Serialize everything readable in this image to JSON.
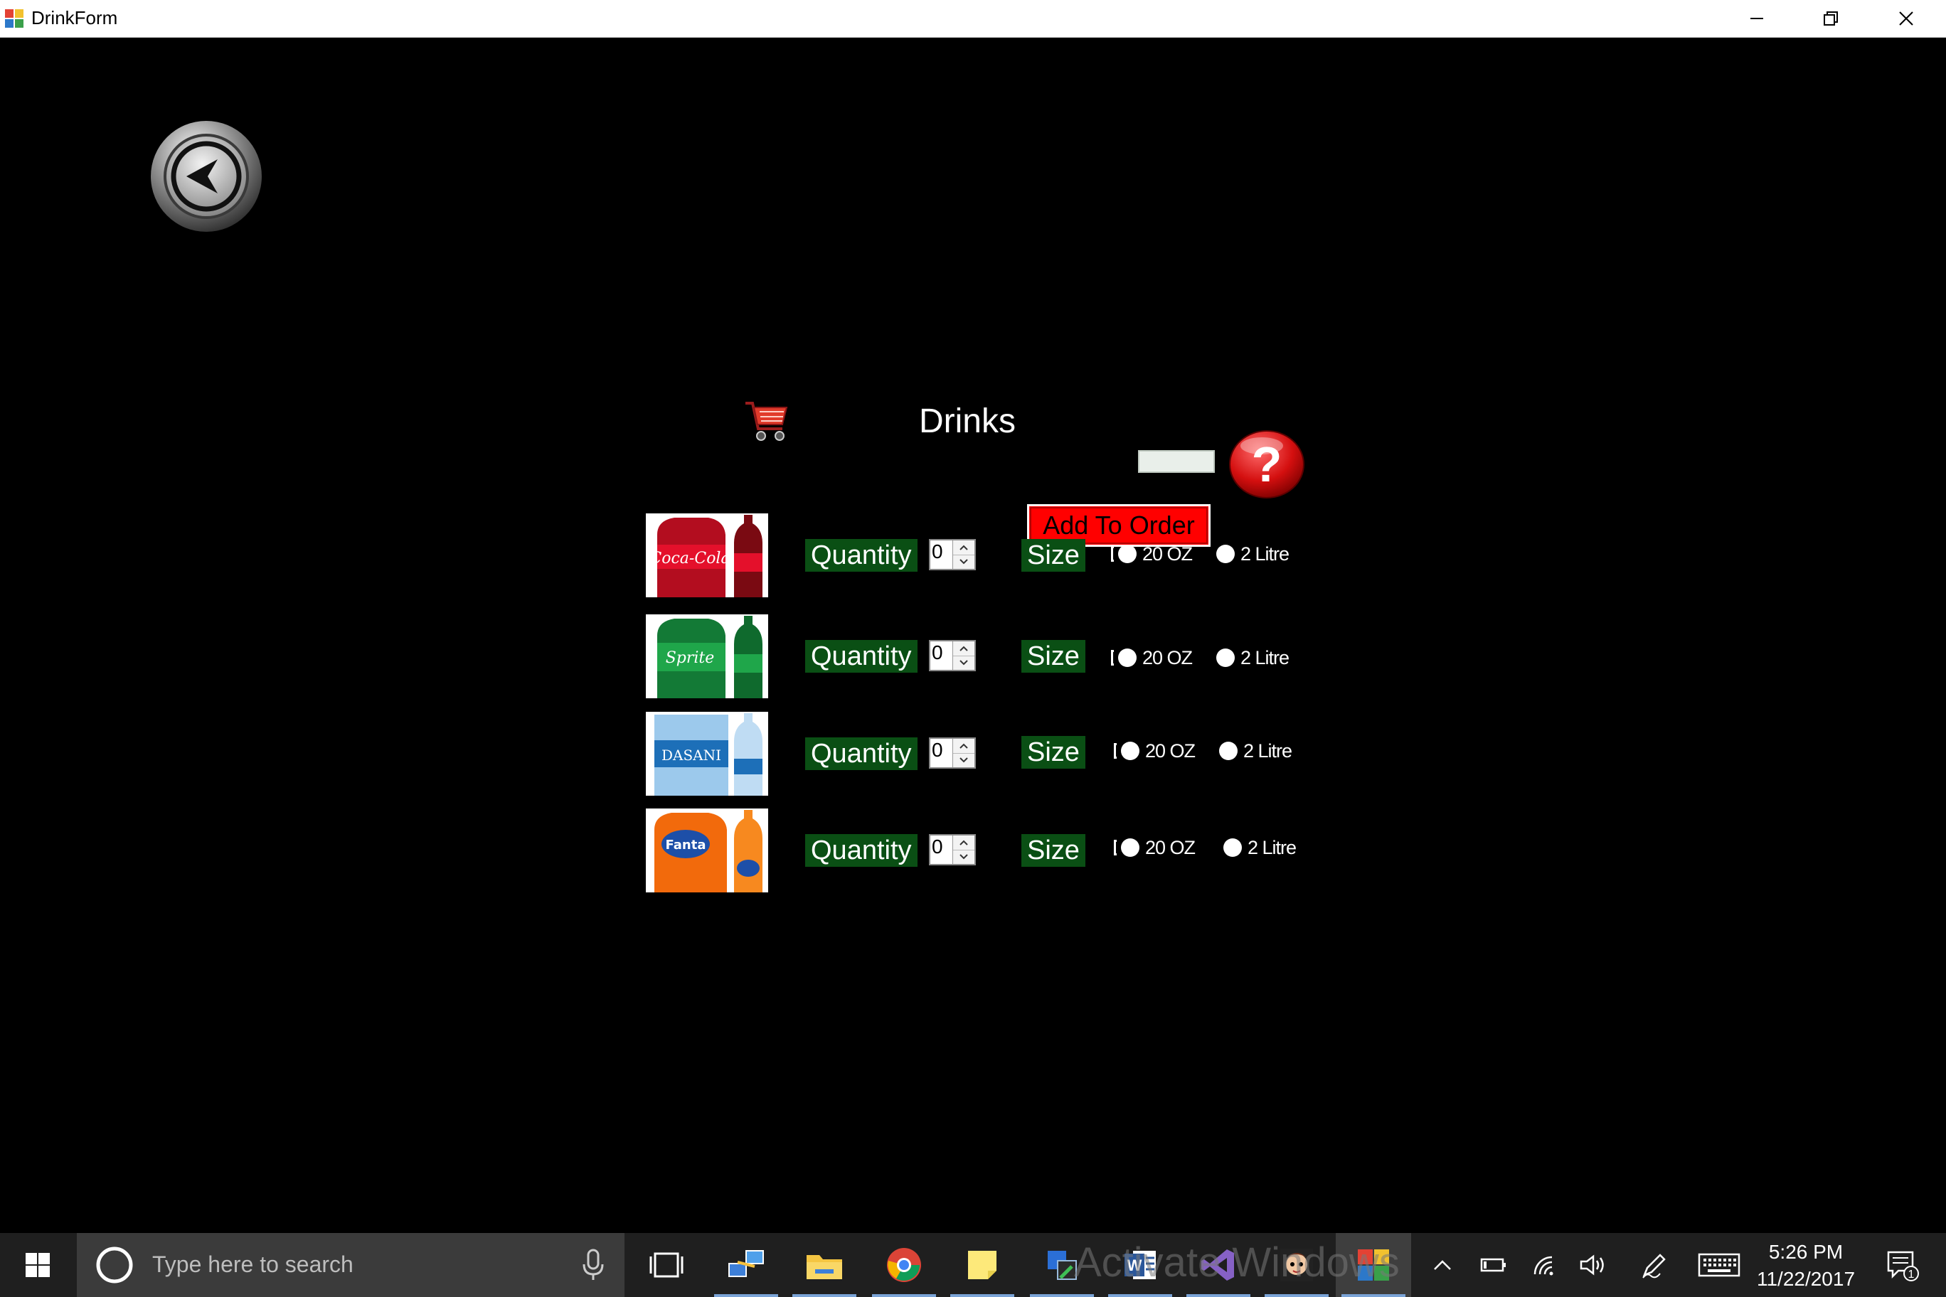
{
  "window": {
    "title": "DrinkForm",
    "minimize_glyph": "─",
    "close_glyph": "✕"
  },
  "form": {
    "title": "Drinks",
    "add_to_order_label": "Add To Order",
    "total_value": "",
    "back_icon": "back-arrow-icon",
    "cart_icon": "shopping-cart-icon",
    "help_icon": "help-question-icon",
    "colors": {
      "background": "#000000",
      "label_bg": "#0a4f14",
      "add_button": "#ff0000"
    }
  },
  "drinks": [
    {
      "product": "Coca-Cola",
      "brand_text": "Coca-Cola",
      "quantity_label": "Quantity",
      "quantity": "0",
      "size_label": "Size",
      "option_small": "20 OZ",
      "option_large": "2 Litre",
      "color": "#c8102e"
    },
    {
      "product": "Sprite",
      "brand_text": "Sprite",
      "quantity_label": "Quantity",
      "quantity": "0",
      "size_label": "Size",
      "option_small": "20 OZ",
      "option_large": "2 Litre",
      "color": "#1b9e3e"
    },
    {
      "product": "Dasani",
      "brand_text": "DASANI",
      "quantity_label": "Quantity",
      "quantity": "0",
      "size_label": "Size",
      "option_small": "20 OZ",
      "option_large": "2 Litre",
      "color": "#1d6fb8"
    },
    {
      "product": "Fanta",
      "brand_text": "Fanta",
      "quantity_label": "Quantity",
      "quantity": "0",
      "size_label": "Size",
      "option_small": "20 OZ",
      "option_large": "2 Litre",
      "color": "#f47a20"
    }
  ],
  "taskbar": {
    "search_placeholder": "Type here to search",
    "watermark": "Activate Windows",
    "apps": [
      "task-view",
      "network-app",
      "file-explorer",
      "chrome",
      "sticky-notes",
      "app-store",
      "word",
      "visual-studio",
      "game-app",
      "drinkform-app"
    ],
    "clock_time": "5:26 PM",
    "clock_date": "11/22/2017",
    "notification_count": "1"
  }
}
